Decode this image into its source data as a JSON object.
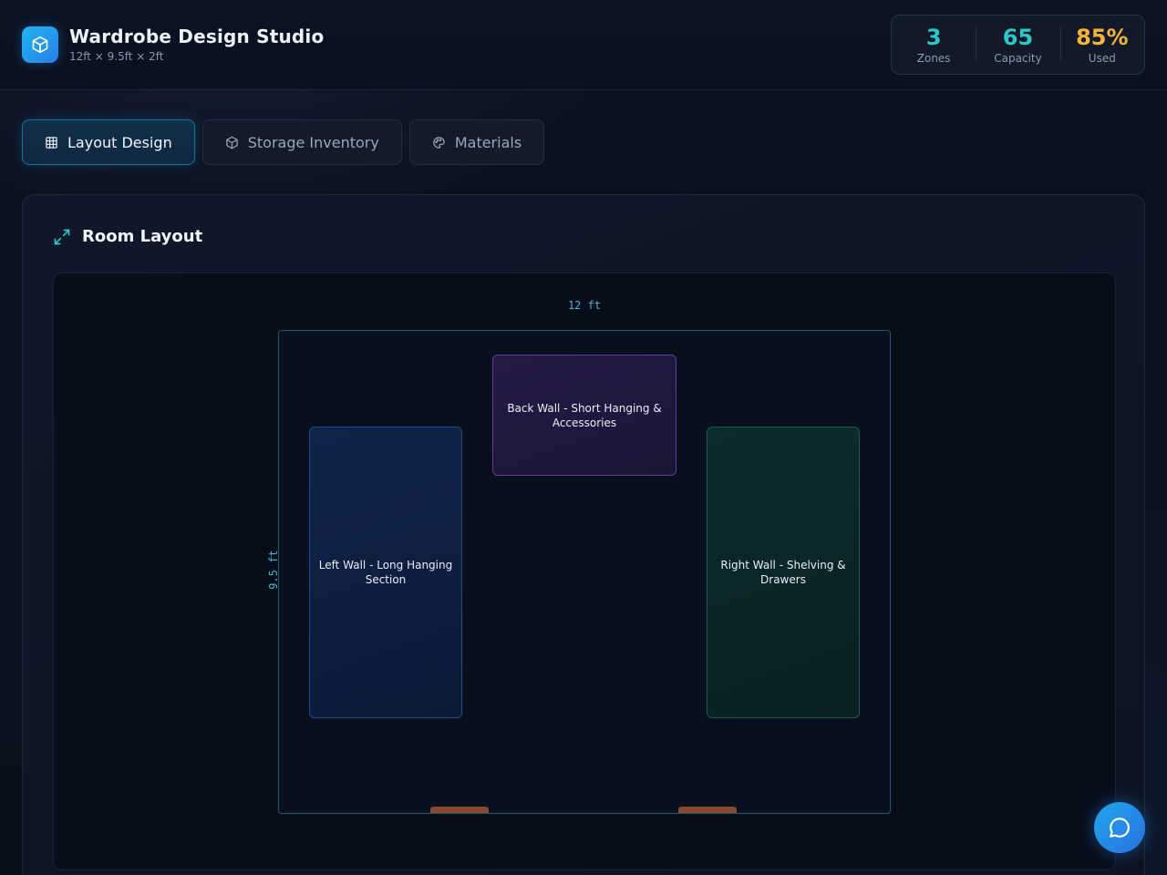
{
  "header": {
    "title": "Wardrobe Design Studio",
    "subtitle": "12ft × 9.5ft × 2ft",
    "logo_icon": "cube-icon"
  },
  "stats": [
    {
      "value": "3",
      "label": "Zones",
      "color": "#2ec7c9"
    },
    {
      "value": "65",
      "label": "Capacity",
      "color": "#2ec7c9"
    },
    {
      "value": "85%",
      "label": "Used",
      "color": "#f5b43a"
    }
  ],
  "tabs": [
    {
      "label": "Layout Design",
      "icon": "grid-icon",
      "active": true
    },
    {
      "label": "Storage Inventory",
      "icon": "box-icon",
      "active": false
    },
    {
      "label": "Materials",
      "icon": "palette-icon",
      "active": false
    }
  ],
  "panel": {
    "title": "Room Layout",
    "icon": "expand-icon"
  },
  "room": {
    "width_label": "12 ft",
    "height_label": "9.5 ft",
    "zones": [
      {
        "label": "Left Wall - Long Hanging Section",
        "color": "#1e4a8a"
      },
      {
        "label": "Back Wall - Short Hanging & Accessories",
        "color": "#5b3f92"
      },
      {
        "label": "Right Wall - Shelving & Drawers",
        "color": "#145a52"
      }
    ],
    "door_color": "#8a4a32"
  },
  "fab": {
    "icon": "chat-icon"
  }
}
